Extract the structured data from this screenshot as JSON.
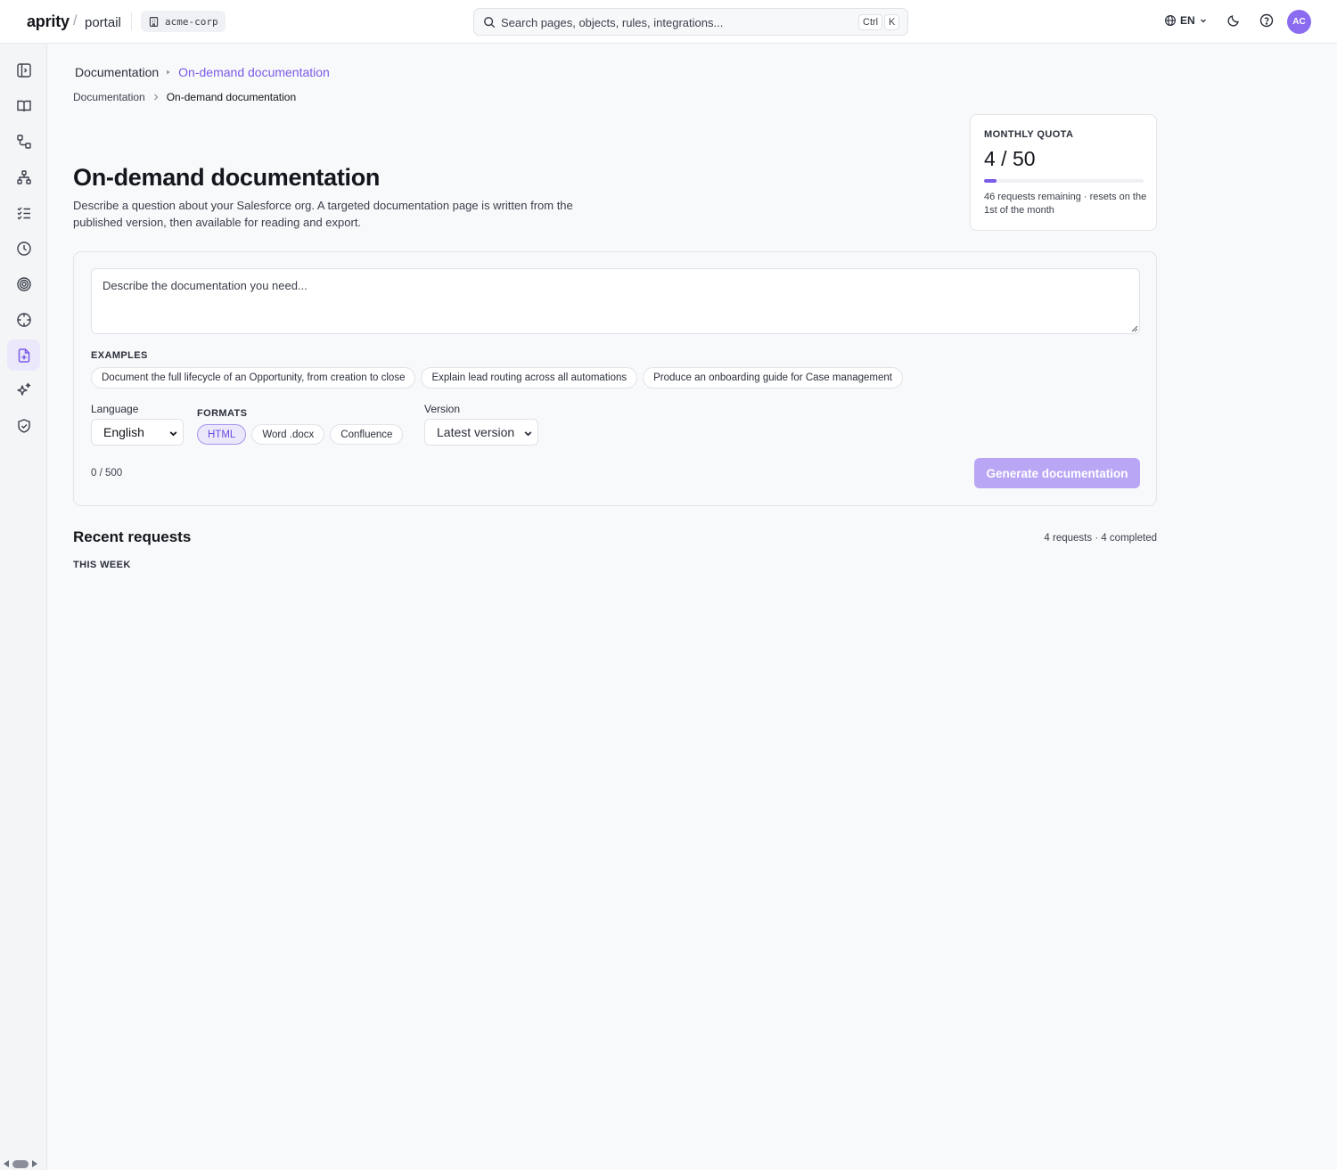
{
  "brand": {
    "name": "aprity",
    "separator": "/",
    "product": "portail"
  },
  "org": {
    "name": "acme-corp",
    "icon": "building-icon"
  },
  "search": {
    "placeholder": "Search pages, objects, rules, integrations...",
    "kbd_ctrl": "Ctrl",
    "kbd_key": "K"
  },
  "topbar": {
    "language": "EN",
    "avatar_initials": "AC"
  },
  "sidebar": {
    "items": [
      {
        "icon": "sidebar-toggle-icon"
      },
      {
        "icon": "book-icon"
      },
      {
        "icon": "flow-icon"
      },
      {
        "icon": "hierarchy-icon"
      },
      {
        "icon": "checklist-icon"
      },
      {
        "icon": "clock-icon"
      },
      {
        "icon": "target-icon"
      },
      {
        "icon": "crosshair-icon"
      },
      {
        "icon": "file-plus-icon",
        "active": true
      },
      {
        "icon": "sparkles-icon"
      },
      {
        "icon": "shield-check-icon"
      }
    ]
  },
  "breadcrumb_top": {
    "parent": "Documentation",
    "current": "On-demand documentation"
  },
  "breadcrumb": {
    "parent": "Documentation",
    "current": "On-demand documentation"
  },
  "page": {
    "title": "On-demand documentation",
    "description": "Describe a question about your Salesforce org. A targeted documentation page is written from the published version, then available for reading and export."
  },
  "quota": {
    "label": "MONTHLY QUOTA",
    "value": "4 / 50",
    "used": 4,
    "limit": 50,
    "note": "46 requests remaining · resets on the 1st of the month"
  },
  "form": {
    "placeholder": "Describe the documentation you need...",
    "examples_label": "EXAMPLES",
    "examples": [
      "Document the full lifecycle of an Opportunity, from creation to close",
      "Explain lead routing across all automations",
      "Produce an onboarding guide for Case management"
    ],
    "language_label": "Language",
    "language_value": "English",
    "formats_label": "FORMATS",
    "formats": [
      {
        "label": "HTML",
        "selected": true
      },
      {
        "label": "Word .docx",
        "selected": false
      },
      {
        "label": "Confluence",
        "selected": false
      }
    ],
    "version_label": "Version",
    "version_value": "Latest version",
    "counter": "0 / 500",
    "generate_label": "Generate documentation"
  },
  "recent": {
    "title": "Recent requests",
    "meta": "4 requests · 4 completed",
    "group_label": "THIS WEEK"
  },
  "colors": {
    "accent": "#7a5ae8",
    "accent_light": "#ece8fb",
    "button_disabled": "#b9a7f5"
  }
}
